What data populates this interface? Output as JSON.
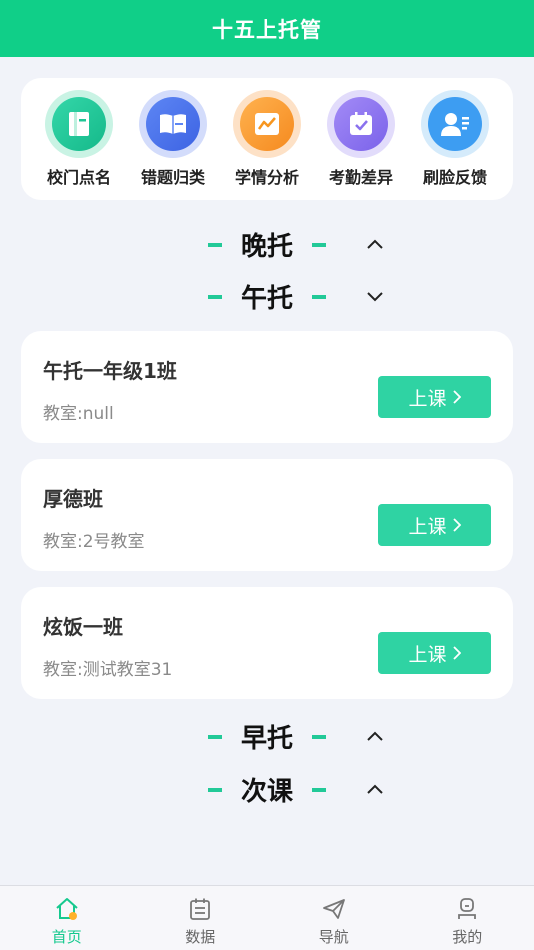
{
  "header": {
    "title": "十五上托管"
  },
  "quick_actions": [
    {
      "label": "校门点名",
      "icon": "notebook-icon"
    },
    {
      "label": "错题归类",
      "icon": "open-book-icon"
    },
    {
      "label": "学情分析",
      "icon": "line-chart-icon"
    },
    {
      "label": "考勤差异",
      "icon": "calendar-check-icon"
    },
    {
      "label": "刷脸反馈",
      "icon": "face-id-icon"
    }
  ],
  "sections": [
    {
      "title": "晚托",
      "state": "collapsed"
    },
    {
      "title": "午托",
      "state": "expanded"
    },
    {
      "title": "早托",
      "state": "collapsed"
    },
    {
      "title": "次课",
      "state": "collapsed"
    }
  ],
  "classes": [
    {
      "name": "午托一年级1班",
      "room": "教室:null",
      "button": "上课"
    },
    {
      "name": "厚德班",
      "room": "教室:2号教室",
      "button": "上课"
    },
    {
      "name": "炫饭一班",
      "room": "教室:测试教室31",
      "button": "上课"
    }
  ],
  "tabs": [
    {
      "label": "首页",
      "active": true
    },
    {
      "label": "数据",
      "active": false
    },
    {
      "label": "导航",
      "active": false
    },
    {
      "label": "我的",
      "active": false
    }
  ],
  "colors": {
    "accent": "#10cf88",
    "button": "#2fd3a3",
    "background": "#f1f3f9"
  }
}
